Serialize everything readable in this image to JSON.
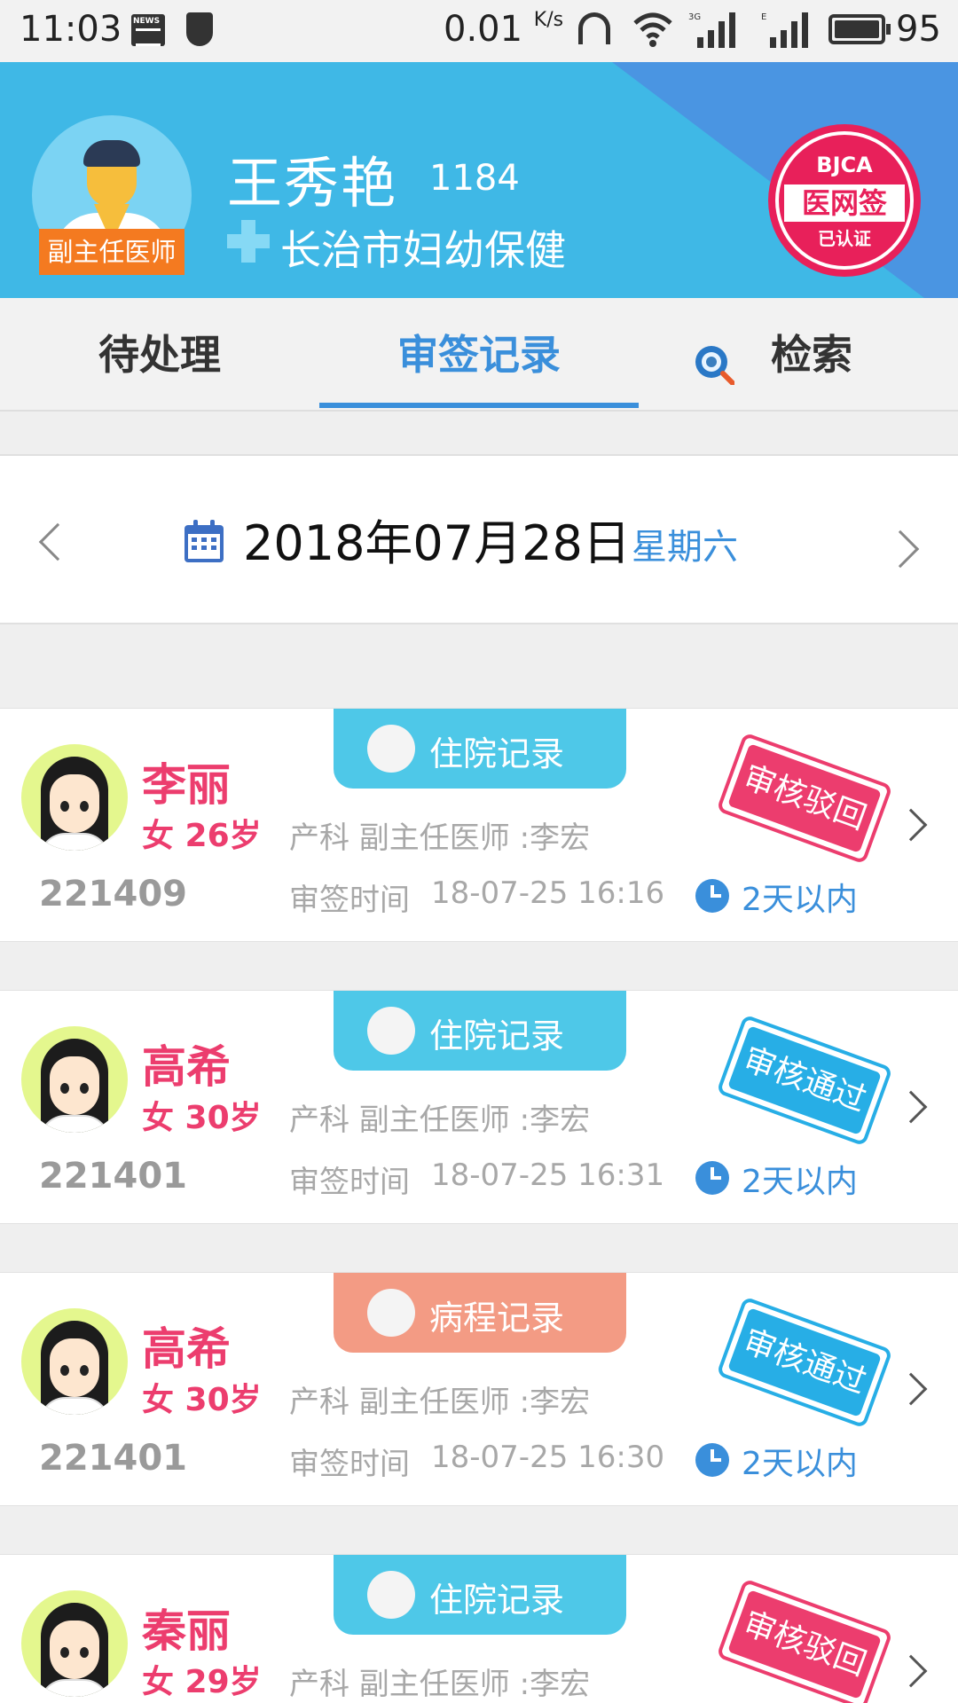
{
  "status_bar": {
    "time": "11:03",
    "speed": "0.01",
    "speed_unit": "K/s",
    "battery": "95"
  },
  "header": {
    "doctor_name": "王秀艳",
    "doctor_id": "1184",
    "hospital": "长治市妇幼保健",
    "role": "副主任医师",
    "seal": {
      "line1": "BJCA",
      "line2": "医网签",
      "line3": "已认证"
    }
  },
  "tabs": {
    "pending": "待处理",
    "records": "审签记录",
    "search": "检索"
  },
  "date_bar": {
    "date": "2018年07月28日",
    "weekday": "星期六"
  },
  "records": [
    {
      "name": "李丽",
      "sex_age": "女 26岁",
      "id": "221409",
      "type": "住院记录",
      "dept": "产科 副主任医师 :李宏",
      "time_label": "审签时间",
      "time": "18-07-25 16:16",
      "within": "2天以内",
      "status": "审核驳回"
    },
    {
      "name": "高希",
      "sex_age": "女 30岁",
      "id": "221401",
      "type": "住院记录",
      "dept": "产科 副主任医师 :李宏",
      "time_label": "审签时间",
      "time": "18-07-25 16:31",
      "within": "2天以内",
      "status": "审核通过"
    },
    {
      "name": "高希",
      "sex_age": "女 30岁",
      "id": "221401",
      "type": "病程记录",
      "dept": "产科 副主任医师 :李宏",
      "time_label": "审签时间",
      "time": "18-07-25 16:30",
      "within": "2天以内",
      "status": "审核通过"
    },
    {
      "name": "秦丽",
      "sex_age": "女 29岁",
      "type": "住院记录",
      "dept": "产科 副主任医师 :李宏",
      "status": "审核驳回"
    }
  ],
  "colors": {
    "header_bg": "#3fb8e6",
    "accent_blue": "#3a8fdb",
    "reject_red": "#ec3d6e",
    "pass_blue": "#27aee6",
    "role_orange": "#f47a20"
  }
}
